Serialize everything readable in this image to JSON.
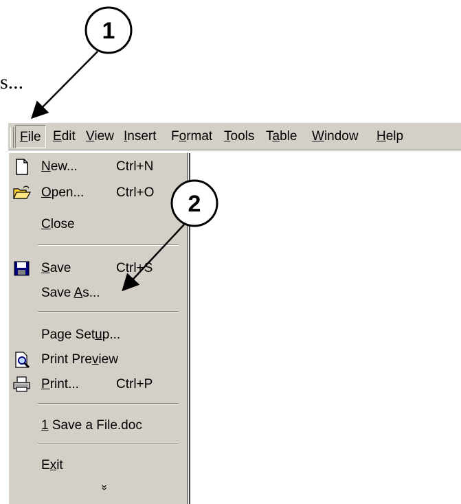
{
  "partial_text": "s...",
  "menubar": {
    "items": [
      {
        "label": "File",
        "mnemonic_index": 0
      },
      {
        "label": "Edit",
        "mnemonic_index": 0
      },
      {
        "label": "View",
        "mnemonic_index": 0
      },
      {
        "label": "Insert",
        "mnemonic_index": 0
      },
      {
        "label": "Format",
        "mnemonic_index": 1
      },
      {
        "label": "Tools",
        "mnemonic_index": 0
      },
      {
        "label": "Table",
        "mnemonic_index": 1
      },
      {
        "label": "Window",
        "mnemonic_index": 0
      },
      {
        "label": "Help",
        "mnemonic_index": 0
      }
    ]
  },
  "file_menu": {
    "items": [
      {
        "id": "new",
        "label": "New...",
        "mnemonic_index": 0,
        "shortcut": "Ctrl+N",
        "icon": "new-document-icon"
      },
      {
        "id": "open",
        "label": "Open...",
        "mnemonic_index": 0,
        "shortcut": "Ctrl+O",
        "icon": "open-folder-icon"
      },
      {
        "id": "close",
        "label": "Close",
        "mnemonic_index": 0,
        "shortcut": "",
        "icon": ""
      },
      {
        "id": "save",
        "label": "Save",
        "mnemonic_index": 0,
        "shortcut": "Ctrl+S",
        "icon": "save-disk-icon"
      },
      {
        "id": "save_as",
        "label": "Save As...",
        "mnemonic_index": 5,
        "shortcut": "",
        "icon": ""
      },
      {
        "id": "page_setup",
        "label": "Page Setup...",
        "mnemonic_index": 8,
        "shortcut": "",
        "icon": ""
      },
      {
        "id": "print_preview",
        "label": "Print Preview",
        "mnemonic_index": 9,
        "shortcut": "",
        "icon": "print-preview-icon"
      },
      {
        "id": "print",
        "label": "Print...",
        "mnemonic_index": 0,
        "shortcut": "Ctrl+P",
        "icon": "printer-icon"
      },
      {
        "id": "recent_file",
        "label": "1 Save a File.doc",
        "mnemonic_index": 0,
        "shortcut": "",
        "icon": ""
      },
      {
        "id": "exit",
        "label": "Exit",
        "mnemonic_index": 1,
        "shortcut": "",
        "icon": ""
      }
    ],
    "expand_glyph": "»"
  },
  "callouts": [
    {
      "number": "1"
    },
    {
      "number": "2"
    }
  ]
}
